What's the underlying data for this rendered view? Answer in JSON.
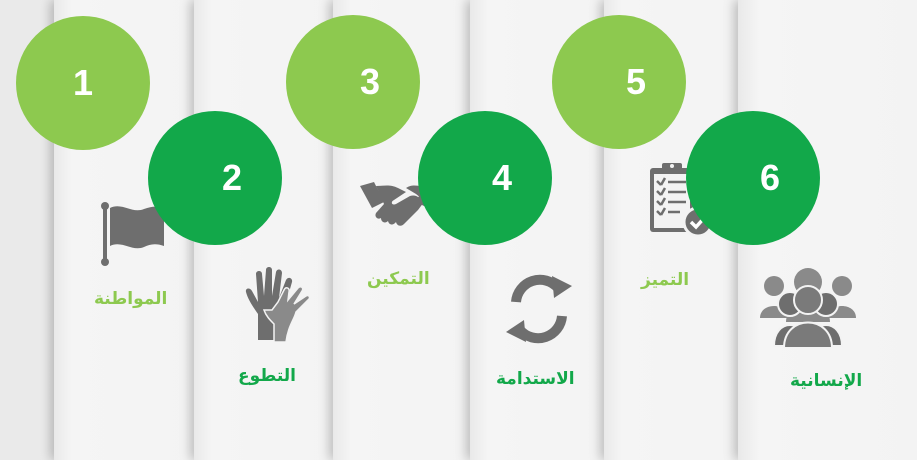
{
  "colors": {
    "light_green": "#8dc94f",
    "dark_green": "#12a84a",
    "icon_gray": "#6e6e6e",
    "panel": "#f3f3f3"
  },
  "steps": [
    {
      "number": "1",
      "label": "المواطنة",
      "icon": "flag-icon"
    },
    {
      "number": "2",
      "label": "التطوع",
      "icon": "hands-icon"
    },
    {
      "number": "3",
      "label": "التمكين",
      "icon": "handshake-icon"
    },
    {
      "number": "4",
      "label": "الاستدامة",
      "icon": "recycle-arrows-icon"
    },
    {
      "number": "5",
      "label": "التميز",
      "icon": "clipboard-check-icon"
    },
    {
      "number": "6",
      "label": "الإنسانية",
      "icon": "group-people-icon"
    }
  ]
}
